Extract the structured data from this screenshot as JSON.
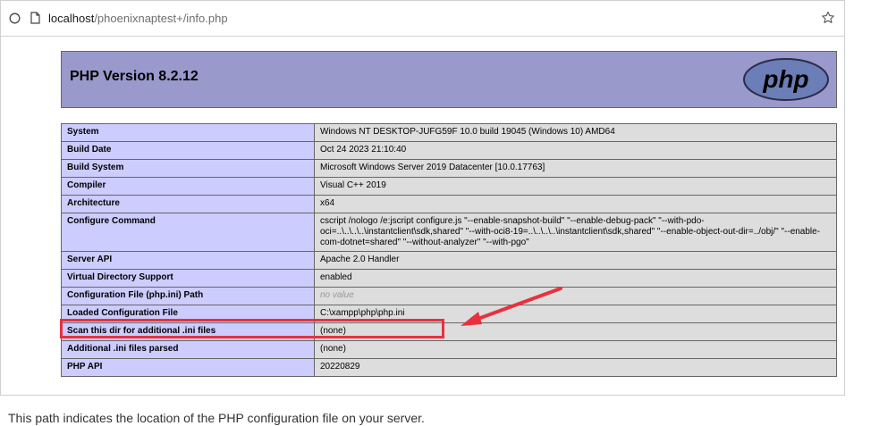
{
  "browser": {
    "url_host": "localhost",
    "url_path": "/phoenixnaptest+/info.php",
    "icons": [
      "shield-icon",
      "page-icon",
      "bookmark-star-icon"
    ]
  },
  "php": {
    "version_title": "PHP Version 8.2.12",
    "logo_text": "php"
  },
  "table": {
    "rows": [
      {
        "key": "System",
        "value": "Windows NT DESKTOP-JUFG59F 10.0 build 19045 (Windows 10) AMD64"
      },
      {
        "key": "Build Date",
        "value": "Oct 24 2023 21:10:40"
      },
      {
        "key": "Build System",
        "value": "Microsoft Windows Server 2019 Datacenter [10.0.17763]"
      },
      {
        "key": "Compiler",
        "value": "Visual C++ 2019"
      },
      {
        "key": "Architecture",
        "value": "x64"
      },
      {
        "key": "Configure Command",
        "value": "cscript /nologo /e:jscript configure.js \"--enable-snapshot-build\" \"--enable-debug-pack\" \"--with-pdo-oci=..\\..\\..\\..\\instantclient\\sdk,shared\" \"--with-oci8-19=..\\..\\..\\..\\instantclient\\sdk,shared\" \"--enable-object-out-dir=../obj/\" \"--enable-com-dotnet=shared\" \"--without-analyzer\" \"--with-pgo\""
      },
      {
        "key": "Server API",
        "value": "Apache 2.0 Handler"
      },
      {
        "key": "Virtual Directory Support",
        "value": "enabled"
      },
      {
        "key": "Configuration File (php.ini) Path",
        "value": "no value"
      },
      {
        "key": "Loaded Configuration File",
        "value": "C:\\xampp\\php\\php.ini"
      },
      {
        "key": "Scan this dir for additional .ini files",
        "value": "(none)"
      },
      {
        "key": "Additional .ini files parsed",
        "value": "(none)"
      },
      {
        "key": "PHP API",
        "value": "20220829"
      }
    ]
  },
  "annotation": {
    "highlight_color": "#e8313e"
  },
  "caption": "This path indicates the location of the PHP configuration file on your server."
}
